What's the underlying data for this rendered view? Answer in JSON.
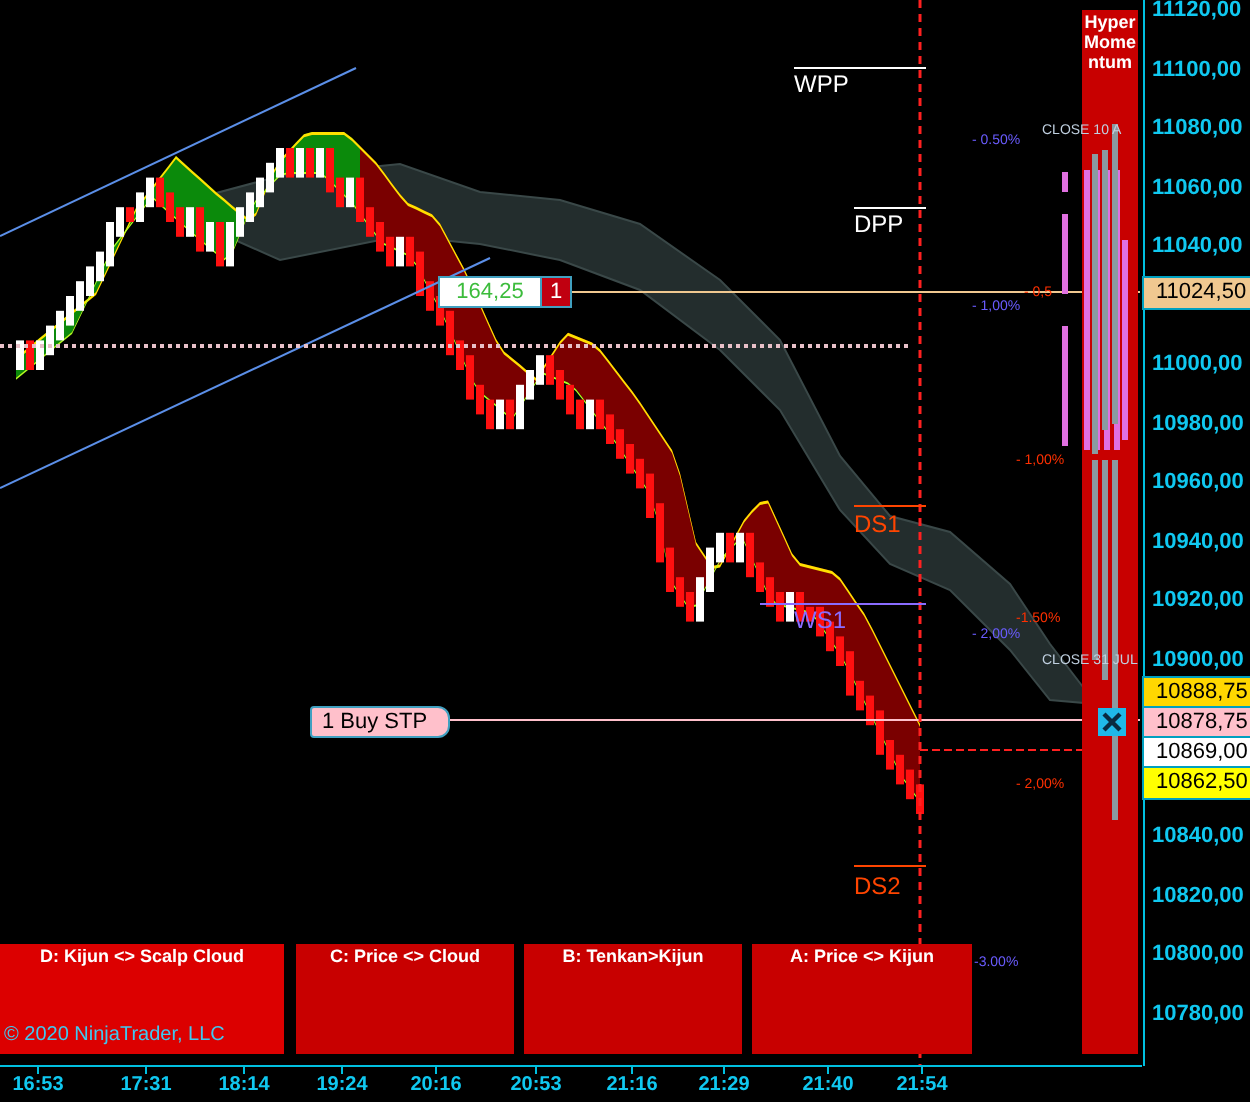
{
  "price_axis": {
    "labels": [
      "11120,00",
      "11100,00",
      "11080,00",
      "11060,00",
      "11040,00",
      "11000,00",
      "10980,00",
      "10960,00",
      "10940,00",
      "10920,00",
      "10900,00",
      "10840,00",
      "10820,00",
      "10800,00",
      "10780,00"
    ]
  },
  "price_markers": [
    {
      "value": "11024,50",
      "color": "#f0c890"
    },
    {
      "value": "10888,75",
      "color": "#ffd700"
    },
    {
      "value": "10878,75",
      "color": "#ffc0cb"
    },
    {
      "value": "10869,00",
      "color": "#ffffff"
    },
    {
      "value": "10862,50",
      "color": "#ffff00"
    }
  ],
  "pivots": [
    {
      "label": "WPP",
      "color": "#ffffff"
    },
    {
      "label": "DPP",
      "color": "#ffffff"
    },
    {
      "label": "DS1",
      "color": "#ff4500"
    },
    {
      "label": "WS1",
      "color": "#8a6cff"
    },
    {
      "label": "DS2",
      "color": "#ff4500"
    }
  ],
  "percent_labels": [
    {
      "text": "- 0.50%",
      "color": "#6a5cff"
    },
    {
      "text": "- 1,00%",
      "color": "#6a5cff"
    },
    {
      "text": "- 0,5",
      "color": "#ff3000"
    },
    {
      "text": "- 1,00%",
      "color": "#ff3000"
    },
    {
      "text": "-1.50%",
      "color": "#ff3000"
    },
    {
      "text": "- 2,00%",
      "color": "#6a5cff"
    },
    {
      "text": "- 2,00%",
      "color": "#ff3000"
    },
    {
      "text": "-3.00%",
      "color": "#6a5cff"
    }
  ],
  "close_labels": [
    "CLOSE 10 A",
    "CLOSE 31 JUL"
  ],
  "momentum_panel": {
    "title": "Hyper Momentum"
  },
  "position": {
    "pnl": "164,25",
    "quantity": "1"
  },
  "order": {
    "label": "1 Buy STP"
  },
  "signal_panels": [
    "D: Kijun <> Scalp Cloud",
    "C: Price <> Cloud",
    "B: Tenkan>Kijun",
    "A: Price <> Kijun"
  ],
  "copyright": "© 2020 NinjaTrader, LLC",
  "time_axis": {
    "labels": [
      "16:53",
      "17:31",
      "18:14",
      "19:24",
      "20:16",
      "20:53",
      "21:16",
      "21:29",
      "21:40",
      "21:54"
    ]
  }
}
